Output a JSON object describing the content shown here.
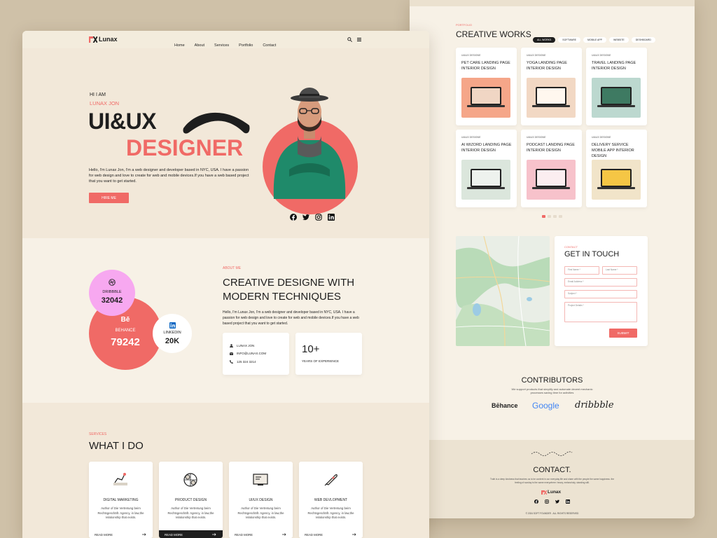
{
  "nav": {
    "logo": "Lunax",
    "items": [
      "Home",
      "About",
      "Services",
      "Portfolio",
      "Contact"
    ]
  },
  "hero": {
    "greeting": "HI I AM",
    "name": "LUNAX JON",
    "title1": "UI&UX",
    "title2": "DESIGNER",
    "desc": "Hello, I'm Lunax Jon, I'm a web designer and developer based in NYC, USA. I have a passion for web design and love to create for web and mobile devices.If you have a web based project that you want to get started.",
    "button": "HIRE ME"
  },
  "stats": {
    "dribbble": {
      "label": "DRIBBBLE",
      "value": "32042"
    },
    "behance": {
      "icon": "Bē",
      "label": "BEHANCE",
      "value": "79242"
    },
    "linkedin": {
      "label": "LINKEDIN",
      "value": "20K"
    }
  },
  "about": {
    "tag": "ABOUT ME",
    "title1": "CREATIVE DESIGNE WITH",
    "title2": "MODERN TECHNIQUES",
    "desc": "Hello, I'm Lunax Jon, I'm a web designer and developer based in NYC, USA. I have a passion for web design and love to create for web and mobile devices.If you have a web based project that you want to get started.",
    "contact_name": "LUNAX JON",
    "contact_email": "INFO@LUNAX.COM",
    "contact_phone": "125 324 3214",
    "years": "10+",
    "years_label": "YEARS OF EXPERIENCE"
  },
  "services": {
    "tag": "SERVICES",
    "title": "WHAT I DO",
    "desc": "Author of Die Vertretung beim Rechtsgeschäft. Agency, in law,the relationship that exists.",
    "read_more": "READ MORE",
    "items": [
      "DIGITAL MARKETING",
      "PRODUCT DESIGN",
      "UI/UX DESIGN",
      "WEB DEVLOPMENT"
    ]
  },
  "portfolio": {
    "tag": "PORTFOLIO",
    "title": "CREATIVE WORKS",
    "filters": [
      "ALL WORKS",
      "SOFTWARE",
      "MOBILE APP",
      "WEBSITE",
      "DESHBOARD"
    ],
    "category": "UI&UX DESIGNE",
    "items": [
      {
        "title": "PET CARE LANDING PAGE INTERIOR DESIGN",
        "bg": "#f5a689",
        "screen": "#f0d6c4"
      },
      {
        "title": "YOGA LANDING PAGE INTERIOR DESIGN",
        "bg": "#f2d8c4",
        "screen": "#fff7ef"
      },
      {
        "title": "TRAVEL LANDING PAGE INTERIOR DESIGN",
        "bg": "#bcd8cf",
        "screen": "#3e7a62"
      },
      {
        "title": "AI WIZORD LANDING PAGE INTERIOR DESIGN",
        "bg": "#dbe6dc",
        "screen": "#eef2ee"
      },
      {
        "title": "PODCAST LANDING PAGE INTERIOR DESIGN",
        "bg": "#f7c2cb",
        "screen": "#fbeef0"
      },
      {
        "title": "DELIVERY SERVICE MOBILE APP INTERIOR DESIGN",
        "bg": "#f1e4c9",
        "screen": "#f5c645"
      }
    ]
  },
  "contact_form": {
    "tag": "CONTACT",
    "title": "GET IN TOUCH",
    "first": "First Name *",
    "last": "Last Name *",
    "email": "Email Address *",
    "subject": "Subject *",
    "details": "Project Details *",
    "submit": "SUBMIT"
  },
  "contributors": {
    "title": "CONTRIBUTORS",
    "desc": "We support products that simplify and automate decent mechanic processes saving time for activities",
    "logos": [
      "Bēhance",
      "Google",
      "dribbble"
    ]
  },
  "footer": {
    "title": "CONTACT.",
    "desc": "Truth is a deep kindness that teaches us to be content in our everyday life and share with the people the same happiness. the feeling of sunday is the same everywhere: heavy, melancholy, standing still.",
    "logo": "Lunax",
    "copyright": "© 2024 SOFT FOUNDER . ALL RIGHTS RESERVED"
  },
  "colors": {
    "accent": "#f06a66",
    "cream": "#f7f1e6",
    "background": "#cfc1a8",
    "pink": "#f7a8f0"
  }
}
